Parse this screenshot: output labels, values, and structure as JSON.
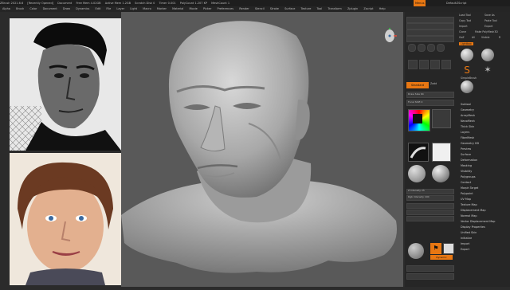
{
  "titlebar": {
    "items": [
      "ZBrush 2021.6.6",
      "[Recently Opened]",
      "Document",
      "Free Mem 4.02GB",
      "Active Mem 1.2GB",
      "Scratch Disk 0",
      "Timer 0.001",
      "PolyCount 1.207 KP",
      "MeshCount 1"
    ],
    "menus_label": "Menus",
    "script_label": "DefaultZScript"
  },
  "menubar": {
    "items": [
      "Alpha",
      "Brush",
      "Color",
      "Document",
      "Draw",
      "Dynamics",
      "Edit",
      "File",
      "Layer",
      "Light",
      "Macro",
      "Marker",
      "Material",
      "Movie",
      "Picker",
      "Preferences",
      "Render",
      "Stencil",
      "Stroke",
      "Surface",
      "Texture",
      "Tool",
      "Transform",
      "Zplugin",
      "Zscript",
      "Help"
    ]
  },
  "right_panel": {
    "col1": {
      "brush_label": "Standard",
      "zadd_label": "Zadd",
      "alpha_label": "Alpha Off",
      "texture_label": "Texture Off",
      "material_label": "MatCap Gray",
      "draw_size_label": "Draw Size 64",
      "focal_label": "Focal Shift 0",
      "intensity_label": "Z Intensity 25",
      "rgb_label": "Rgb Intensity 100",
      "bottom_label": "Dynamic"
    },
    "col2": {
      "header_items": [
        "Load Tool",
        "Save As",
        "Copy Tool",
        "Paste Tool",
        "Import",
        "Export",
        "Clone",
        "Make PolyMesh3D",
        "GoZ",
        "All",
        "Visible",
        "R"
      ],
      "lightbox_label": "Lightbox",
      "subtool_label": "SimpleBrush",
      "menu_items": [
        "Subtool",
        "Geometry",
        "ArrayMesh",
        "NanoMesh",
        "Thick Skin",
        "Layers",
        "FiberMesh",
        "Geometry HD",
        "Preview",
        "Surface",
        "Deformation",
        "Masking",
        "Visibility",
        "Polygroups",
        "Contact",
        "Morph Target",
        "Polypaint",
        "UV Map",
        "Texture Map",
        "Displacement Map",
        "Normal Map",
        "Vector Displacement Map",
        "Display Properties",
        "Unified Skin",
        "Initialize",
        "Import",
        "Export"
      ]
    }
  },
  "colors": {
    "accent": "#e87712",
    "canvas_bg": "#595959",
    "panel_bg": "#262626"
  }
}
